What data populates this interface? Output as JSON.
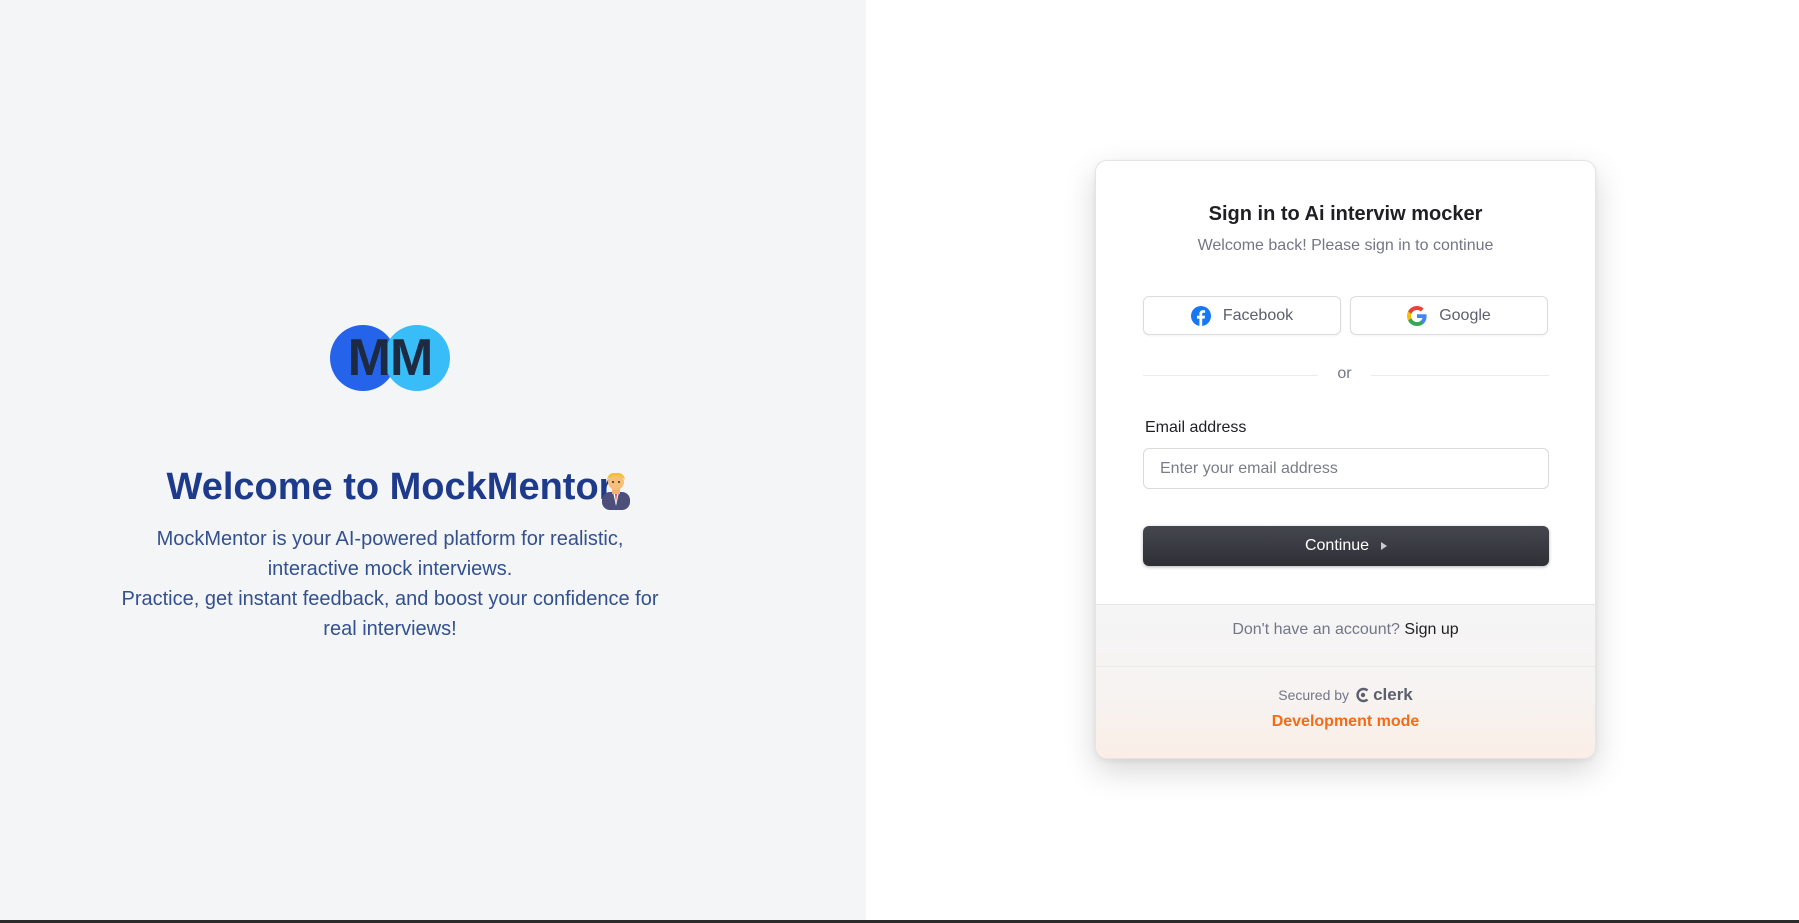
{
  "left": {
    "logo_text": "MM",
    "welcome_title": "Welcome to MockMentor",
    "title_icon": "person-in-suit-icon",
    "description_line1": "MockMentor is your AI-powered platform for realistic, interactive mock interviews.",
    "description_line2": "Practice, get instant feedback, and boost your confidence for real interviews!"
  },
  "card": {
    "title": "Sign in to Ai interviw mocker",
    "subtitle": "Welcome back! Please sign in to continue",
    "facebook_label": "Facebook",
    "google_label": "Google",
    "divider_text": "or",
    "email_label": "Email address",
    "email_placeholder": "Enter your email address",
    "email_value": "",
    "continue_label": "Continue",
    "no_account_text": "Don't have an account?",
    "signup_label": "Sign up",
    "secured_by": "Secured by",
    "clerk_label": "clerk",
    "dev_mode": "Development mode"
  },
  "colors": {
    "left_bg": "#f3f5f7",
    "title_color": "#1e3a8a",
    "logo_blue": "#2563eb",
    "logo_light_blue": "#38bdf8",
    "continue_bg": "#2f3036",
    "dev_mode_color": "#f36b16"
  }
}
